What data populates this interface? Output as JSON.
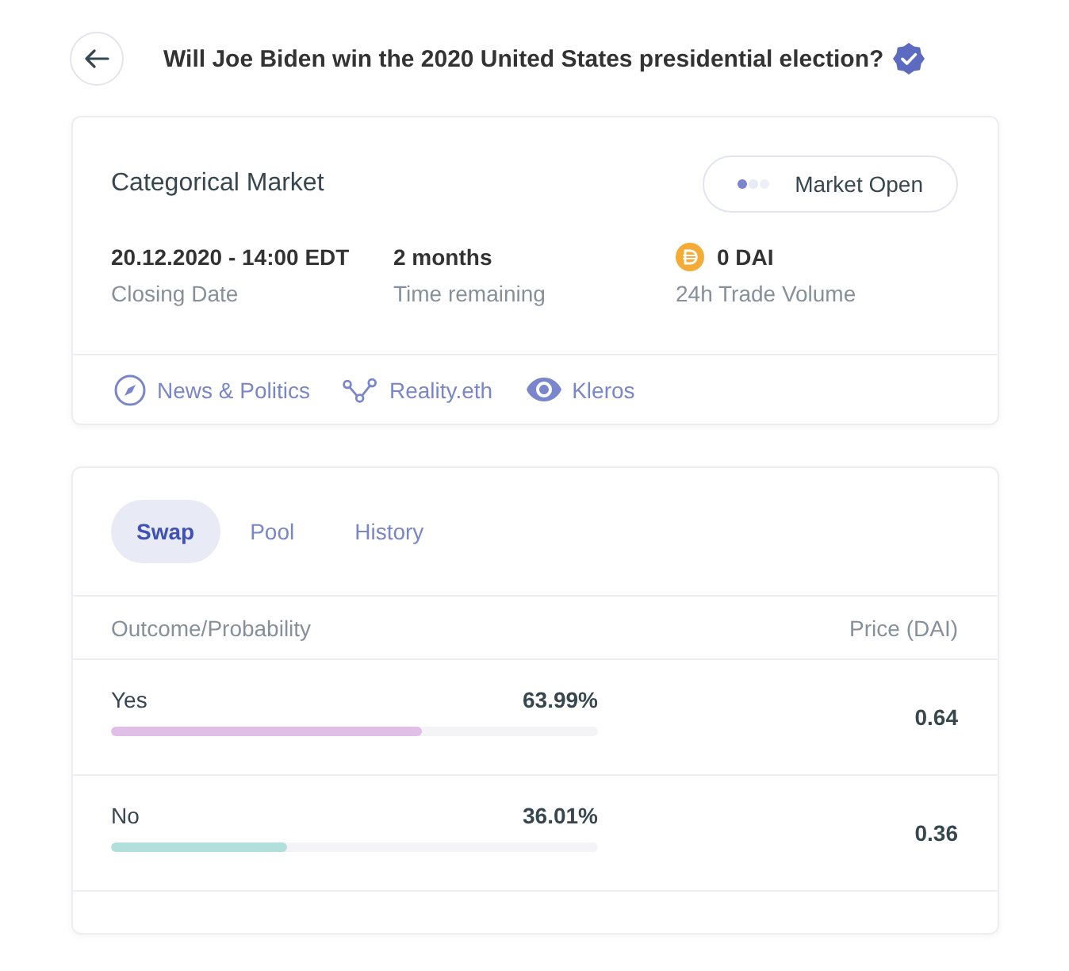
{
  "header": {
    "title": "Will Joe Biden win the 2020 United States presidential election?",
    "verified": true
  },
  "market": {
    "type": "Categorical Market",
    "status": "Market Open",
    "stats": [
      {
        "kind": "plain",
        "value": "20.12.2020 - 14:00 EDT",
        "label": "Closing Date"
      },
      {
        "kind": "plain",
        "value": "2 months",
        "label": "Time remaining"
      },
      {
        "kind": "token",
        "value": "0 DAI",
        "label": "24h Trade Volume"
      }
    ],
    "links": [
      {
        "kind": "category",
        "label": "News & Politics"
      },
      {
        "kind": "oracle",
        "label": "Reality.eth"
      },
      {
        "kind": "arbitrator",
        "label": "Kleros"
      }
    ]
  },
  "trade": {
    "tabs": [
      {
        "label": "Swap",
        "selected": true
      },
      {
        "label": "Pool",
        "selected": false
      },
      {
        "label": "History",
        "selected": false
      }
    ],
    "columns": [
      "Outcome/Probability",
      "Price (DAI)"
    ],
    "outcomes": [
      {
        "name": "Yes",
        "probability": "63.99%",
        "level": 0.6399,
        "color": "#e1bee7",
        "price": "0.64"
      },
      {
        "name": "No",
        "probability": "36.01%",
        "level": 0.3601,
        "color": "#b2dfdb",
        "price": "0.36"
      }
    ]
  }
}
